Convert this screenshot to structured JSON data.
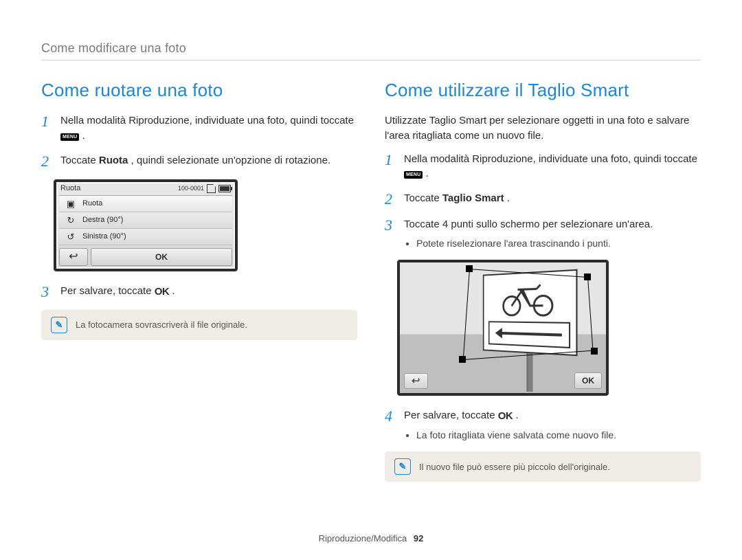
{
  "breadcrumb": "Come modificare una foto",
  "left": {
    "title": "Come ruotare una foto",
    "step1_a": "Nella modalità Riproduzione, individuate una foto, quindi toccate ",
    "step1_b": ".",
    "step2_a": "Toccate ",
    "step2_bold": "Ruota",
    "step2_b": ", quindi selezionate un'opzione di rotazione.",
    "step3_a": "Per salvare, toccate ",
    "step3_b": ".",
    "note": "La fotocamera sovrascriverà il file originale.",
    "menu_label": "MENU",
    "ok_label": "OK",
    "device": {
      "title": "Ruota",
      "counter": "100-0001",
      "items": [
        "Ruota",
        "Destra (90°)",
        "Sinistra (90°)"
      ],
      "back": "↩",
      "ok": "OK"
    }
  },
  "right": {
    "title": "Come utilizzare il Taglio Smart",
    "lead": "Utilizzate Taglio Smart per selezionare oggetti in una foto e salvare l'area ritagliata come un nuovo file.",
    "step1_a": "Nella modalità Riproduzione, individuate una foto, quindi toccate ",
    "step1_b": ".",
    "step2_a": "Toccate ",
    "step2_bold": "Taglio Smart",
    "step2_b": ".",
    "step3": "Toccate 4 punti sullo schermo per selezionare un'area.",
    "step3_sub": "Potete riselezionare l'area trascinando i punti.",
    "step4_a": "Per salvare, toccate ",
    "step4_b": ".",
    "step4_sub": "La foto ritagliata viene salvata come nuovo file.",
    "note": "Il nuovo file può essere più piccolo dell'originale.",
    "menu_label": "MENU",
    "ok_label": "OK",
    "crop_back": "↩",
    "crop_ok": "OK"
  },
  "footer": {
    "section": "Riproduzione/Modifica",
    "page": "92"
  }
}
